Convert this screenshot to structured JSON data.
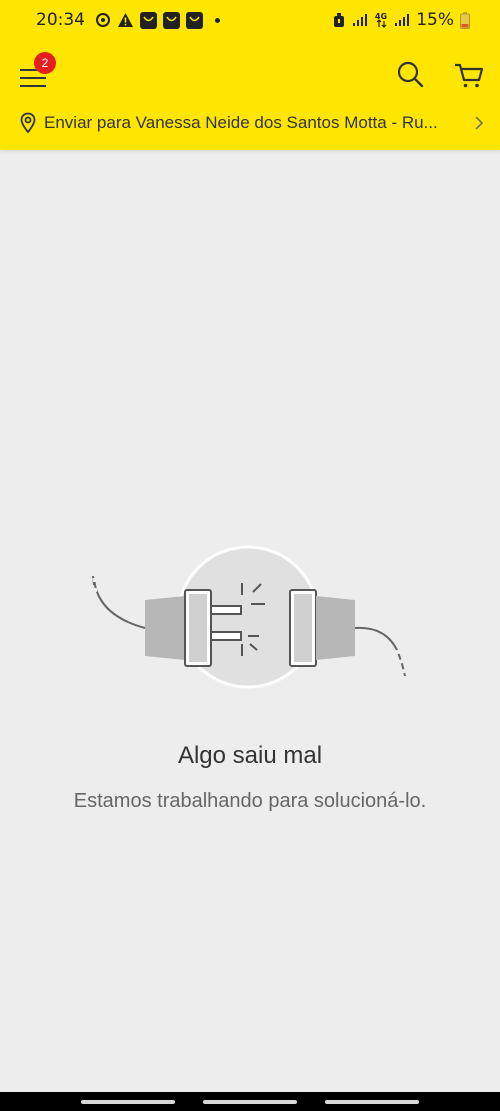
{
  "status_bar": {
    "time": "20:34",
    "network": "4G",
    "battery": "15%"
  },
  "header": {
    "menu_badge_count": "2",
    "address": "Enviar para Vanessa Neide dos Santos Motta - Ru..."
  },
  "error": {
    "title": "Algo saiu mal",
    "message": "Estamos trabalhando para solucioná-lo."
  },
  "colors": {
    "brand_yellow": "#fee600",
    "badge_red": "#e41f1f",
    "background": "#ededed"
  },
  "icons": {
    "menu": "hamburger-menu-icon",
    "search": "search-icon",
    "cart": "cart-icon",
    "location": "location-pin-icon",
    "chevron": "chevron-right-icon"
  }
}
